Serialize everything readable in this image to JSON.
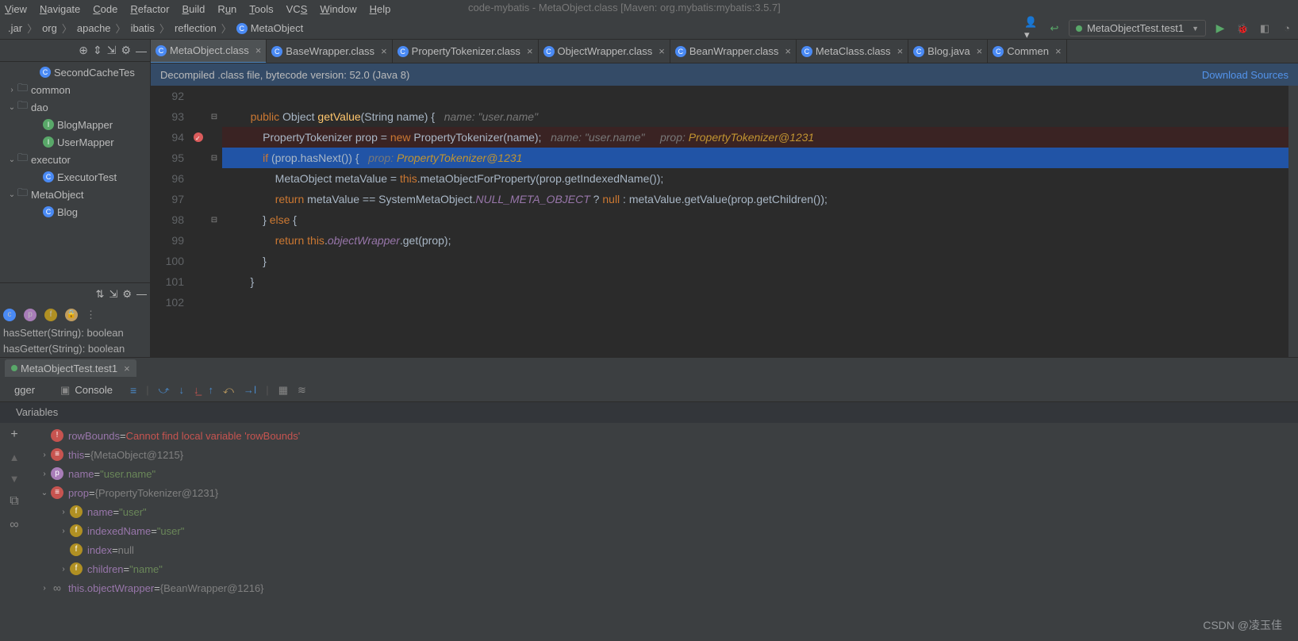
{
  "window_title": "code-mybatis - MetaObject.class [Maven: org.mybatis:mybatis:3.5.7]",
  "menu": [
    "View",
    "Navigate",
    "Code",
    "Refactor",
    "Build",
    "Run",
    "Tools",
    "VCS",
    "Window",
    "Help"
  ],
  "breadcrumbs": [
    ".jar",
    "org",
    "apache",
    "ibatis",
    "reflection",
    "MetaObject"
  ],
  "run_config": "MetaObjectTest.test1",
  "tabs": [
    {
      "label": "MetaObject.class",
      "active": true
    },
    {
      "label": "BaseWrapper.class",
      "active": false
    },
    {
      "label": "PropertyTokenizer.class",
      "active": false
    },
    {
      "label": "ObjectWrapper.class",
      "active": false
    },
    {
      "label": "BeanWrapper.class",
      "active": false
    },
    {
      "label": "MetaClass.class",
      "active": false
    },
    {
      "label": "Blog.java",
      "active": false
    },
    {
      "label": "Commen",
      "active": false
    }
  ],
  "banner": {
    "text": "Decompiled .class file, bytecode version: 52.0 (Java 8)",
    "link": "Download Sources"
  },
  "sidebar": {
    "top": "SecondCacheTes",
    "items": [
      {
        "type": "folder",
        "label": "common",
        "exp": false,
        "indent": 0,
        "chev": "›"
      },
      {
        "type": "folder",
        "label": "dao",
        "exp": true,
        "indent": 0,
        "chev": "⌄"
      },
      {
        "type": "iface",
        "label": "BlogMapper",
        "indent": 2
      },
      {
        "type": "iface",
        "label": "UserMapper",
        "indent": 2
      },
      {
        "type": "folder",
        "label": "executor",
        "exp": true,
        "indent": 0,
        "chev": "⌄"
      },
      {
        "type": "class",
        "label": "ExecutorTest",
        "indent": 2
      },
      {
        "type": "folder",
        "label": "MetaObject",
        "exp": true,
        "indent": 0,
        "chev": "⌄"
      },
      {
        "type": "class",
        "label": "Blog",
        "indent": 2
      }
    ],
    "struct1": "hasSetter(String): boolean",
    "struct2": "hasGetter(String): boolean"
  },
  "code": {
    "start": 92,
    "lines": [
      {
        "n": 92,
        "html": ""
      },
      {
        "n": 93,
        "html": "    <span class='kw'>public</span> Object <span class='fn'>getValue</span>(String name) {   <span class='hint'>name: </span><span class='hint'>\"user.name\"</span>"
      },
      {
        "n": 94,
        "bp": true,
        "html": "        PropertyTokenizer prop = <span class='kw'>new</span> PropertyTokenizer(name);   <span class='hint'>name: \"user.name\"</span>     <span class='hint'>prop: </span><span class='hint-val'>PropertyTokenizer@1231</span>"
      },
      {
        "n": 95,
        "exec": true,
        "html": "        <span class='kw'>if</span> (prop.hasNext()) {   <span class='hint'>prop: </span><span class='hint-val'>PropertyTokenizer@1231</span>"
      },
      {
        "n": 96,
        "html": "            MetaObject metaValue = <span class='kw'>this</span>.metaObjectForProperty(prop.getIndexedName());"
      },
      {
        "n": 97,
        "html": "            <span class='kw'>return</span> metaValue == SystemMetaObject.<span class='fld'>NULL_META_OBJECT</span> ? <span class='kw'>null</span> : metaValue.getValue(prop.getChildren());"
      },
      {
        "n": 98,
        "html": "        } <span class='kw'>else</span> {"
      },
      {
        "n": 99,
        "html": "            <span class='kw'>return this</span>.<span class='fld'>objectWrapper</span>.get(prop);"
      },
      {
        "n": 100,
        "html": "        }"
      },
      {
        "n": 101,
        "html": "    }"
      },
      {
        "n": 102,
        "html": ""
      }
    ]
  },
  "debug": {
    "tab": "MetaObjectTest.test1",
    "sub1": "gger",
    "sub2": "Console",
    "frames_label": "Variables",
    "vars": [
      {
        "indent": 0,
        "chev": "",
        "ico": "warn",
        "name": "rowBounds",
        "eq": " = ",
        "val": "Cannot find local variable 'rowBounds'",
        "cls": "vv-err"
      },
      {
        "indent": 0,
        "chev": "›",
        "ico": "eq",
        "name": "this",
        "eq": " = ",
        "val": "{MetaObject@1215}",
        "cls": "vv-gray"
      },
      {
        "indent": 0,
        "chev": "›",
        "ico": "p",
        "name": "name",
        "eq": " = ",
        "val": "\"user.name\"",
        "cls": "vv"
      },
      {
        "indent": 0,
        "chev": "⌄",
        "ico": "eq",
        "name": "prop",
        "eq": " = ",
        "val": "{PropertyTokenizer@1231}",
        "cls": "vv-gray"
      },
      {
        "indent": 1,
        "chev": "›",
        "ico": "f",
        "name": "name",
        "eq": " = ",
        "val": "\"user\"",
        "cls": "vv"
      },
      {
        "indent": 1,
        "chev": "›",
        "ico": "f",
        "name": "indexedName",
        "eq": " = ",
        "val": "\"user\"",
        "cls": "vv"
      },
      {
        "indent": 1,
        "chev": "",
        "ico": "f",
        "name": "index",
        "eq": " = ",
        "val": "null",
        "cls": "vv-gray"
      },
      {
        "indent": 1,
        "chev": "›",
        "ico": "f",
        "name": "children",
        "eq": " = ",
        "val": "\"name\"",
        "cls": "vv"
      },
      {
        "indent": 0,
        "chev": "›",
        "ico": "inf",
        "name": "this.objectWrapper",
        "eq": " = ",
        "val": "{BeanWrapper@1216}",
        "cls": "vv-gray"
      }
    ]
  },
  "watermark": "CSDN @凌玉佳"
}
